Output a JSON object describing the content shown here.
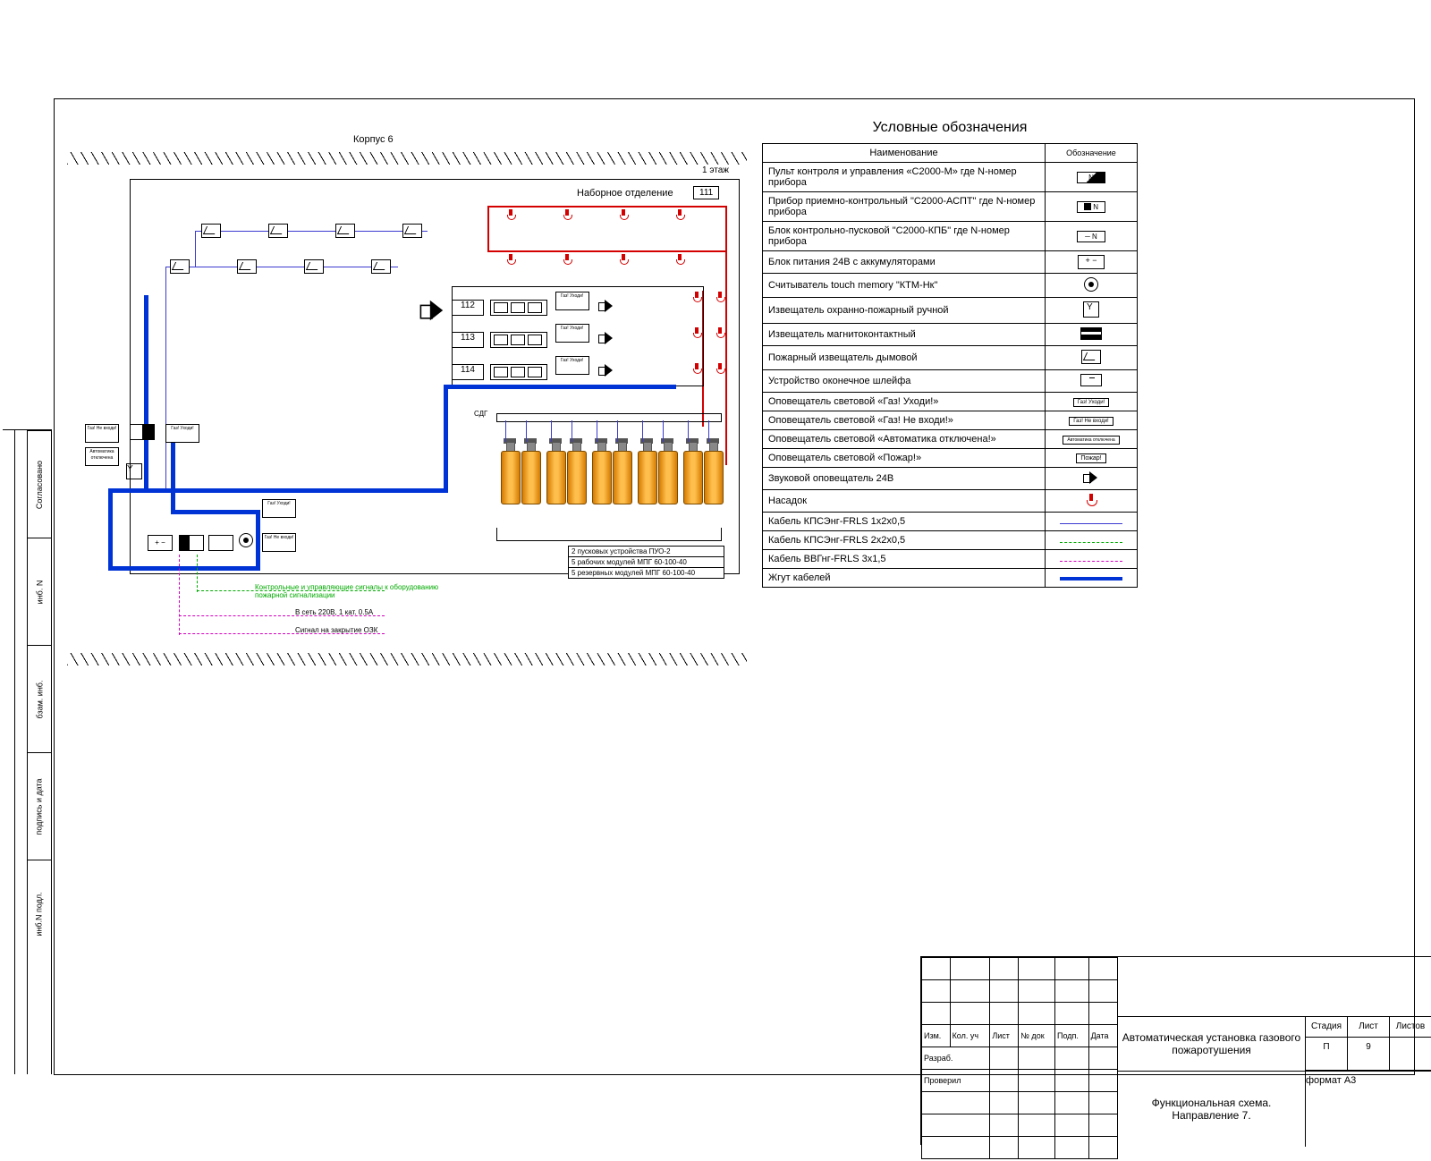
{
  "building": "Корпус 6",
  "floor": "1 этаж",
  "room_title": "Наборное отделение",
  "room_main": "111",
  "subrooms": [
    "112",
    "113",
    "114"
  ],
  "sdg": "СДГ",
  "notes_arrows": {
    "a1": "Контрольные и управляющие сигналы к оборудованию пожарной сигнализации",
    "a2": "В сеть 220В, 1 кат. 0.5А",
    "a3": "Сигнал на закрытие ОЗК"
  },
  "brace_notes": [
    "2 пусковых устройства ПУО-2",
    "5 рабочих модулей МПГ 60-100-40",
    "5 резервных модулей МПГ 60-100-40"
  ],
  "sign_labels": {
    "leave": "Газ! Уходи!",
    "noenter": "Газ! Не входи!",
    "auto_off": "Автоматика отключена",
    "fire": "Пожар!"
  },
  "legend_title": "Условные обозначения",
  "legend_head": {
    "name": "Наименование",
    "sym": "Обозначение"
  },
  "legend": [
    {
      "n": "Пульт контроля и управления «С2000-М» где N-номер прибора",
      "s": "c2000m"
    },
    {
      "n": "Прибор приемно-контрольный \"С2000-АСПТ\" где N-номер прибора",
      "s": "aspt"
    },
    {
      "n": "Блок контрольно-пусковой \"С2000-КПБ\" где N-номер прибора",
      "s": "kpb"
    },
    {
      "n": "Блок питания 24В с аккумуляторами",
      "s": "psu"
    },
    {
      "n": "Считыватель touch memory \"КТМ-Нк\"",
      "s": "dot"
    },
    {
      "n": "Извещатель охранно-пожарный ручной",
      "s": "y"
    },
    {
      "n": "Извещатель магнитоконтактный",
      "s": "mag"
    },
    {
      "n": "Пожарный извещатель дымовой",
      "s": "det"
    },
    {
      "n": "Устройство оконечное шлейфа",
      "s": "end"
    },
    {
      "n": "Оповещатель световой «Газ! Уходи!»",
      "s": "sign_leave"
    },
    {
      "n": "Оповещатель световой «Газ! Не входи!»",
      "s": "sign_noenter"
    },
    {
      "n": "Оповещатель световой «Автоматика отключена!»",
      "s": "sign_auto"
    },
    {
      "n": "Оповещатель световой «Пожар!»",
      "s": "sign_fire"
    },
    {
      "n": "Звуковой оповещатель 24В",
      "s": "speaker"
    },
    {
      "n": "Насадок",
      "s": "nozzle"
    },
    {
      "n": "Кабель КПСЭнг-FRLS 1х2х0,5",
      "s": "l_blue"
    },
    {
      "n": "Кабель КПСЭнг-FRLS 2х2х0,5",
      "s": "l_green"
    },
    {
      "n": "Кабель ВВГнг-FRLS 3х1,5",
      "s": "l_pink"
    },
    {
      "n": "Жгут кабелей",
      "s": "l_thick"
    }
  ],
  "tb": {
    "cols": [
      "Изм.",
      "Кол. уч",
      "Лист",
      "№ док",
      "Подп.",
      "Дата"
    ],
    "rows": [
      "Разраб.",
      "Проверил"
    ],
    "project_title": "Автоматическая установка газового пожаротушения",
    "sheet_title": "Функциональная схема. Направление 7.",
    "stage_h": "Стадия",
    "sheet_h": "Лист",
    "sheets_h": "Листов",
    "stage": "П",
    "sheet": "9",
    "sheets": ""
  },
  "vlabels": [
    "инб.N подл.",
    "подпись и дата",
    "бзам. инб.",
    "инб. N",
    "Согласовано"
  ],
  "format": "формат  А3"
}
